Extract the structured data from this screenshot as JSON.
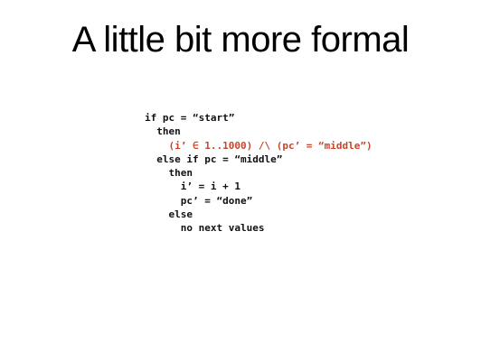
{
  "slide": {
    "title": "A little bit more formal",
    "code_lines": [
      {
        "text": "if pc = “start”",
        "indent": 0,
        "highlight": false
      },
      {
        "text": "then",
        "indent": 1,
        "highlight": false
      },
      {
        "text": "(i’ ∈ 1..1000) /\\ (pc’ = “middle”)",
        "indent": 2,
        "highlight": true
      },
      {
        "text": "else if pc = “middle”",
        "indent": 1,
        "highlight": false
      },
      {
        "text": "then",
        "indent": 2,
        "highlight": false
      },
      {
        "text": "i’ = i + 1",
        "indent": 3,
        "highlight": false
      },
      {
        "text": "pc’ = “done”",
        "indent": 3,
        "highlight": false
      },
      {
        "text": "else",
        "indent": 2,
        "highlight": false
      },
      {
        "text": "no next values",
        "indent": 3,
        "highlight": false
      }
    ],
    "highlight_color": "#c8442b",
    "text_color": "#111111"
  }
}
